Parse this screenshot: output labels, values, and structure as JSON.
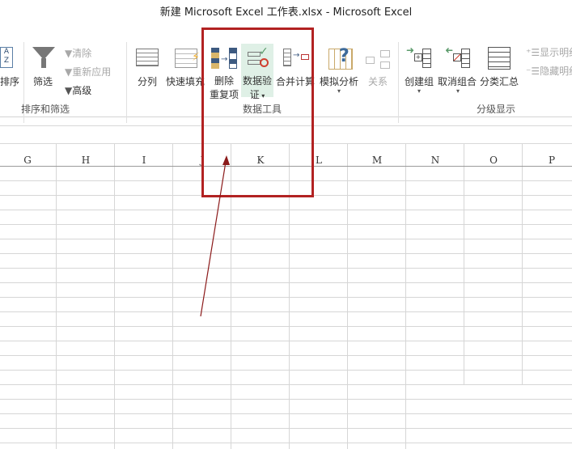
{
  "window": {
    "title": "新建 Microsoft Excel 工作表.xlsx - Microsoft Excel"
  },
  "ribbon": {
    "sort_filter": {
      "sort_label": "排序",
      "filter_label": "筛选",
      "clear_label": "清除",
      "reapply_label": "重新应用",
      "advanced_label": "高级",
      "group_label": "排序和筛选"
    },
    "data_tools": {
      "text_to_columns": "分列",
      "flash_fill": "快速填充",
      "remove_dup_line1": "删除",
      "remove_dup_line2": "重复项",
      "validation_line1": "数据验",
      "validation_line2": "证",
      "consolidate": "合并计算",
      "whatif": "模拟分析",
      "relationships": "关系",
      "group_label": "数据工具"
    },
    "outline": {
      "group": "创建组",
      "ungroup": "取消组合",
      "subtotal": "分类汇总",
      "show_detail": "显示明细",
      "hide_detail": "隐藏明细",
      "group_label": "分级显示"
    }
  },
  "columns": [
    "G",
    "H",
    "I",
    "J",
    "K",
    "L",
    "M",
    "N",
    "O",
    "P"
  ],
  "colors": {
    "annotation": "#b22222",
    "accent": "#217346"
  }
}
